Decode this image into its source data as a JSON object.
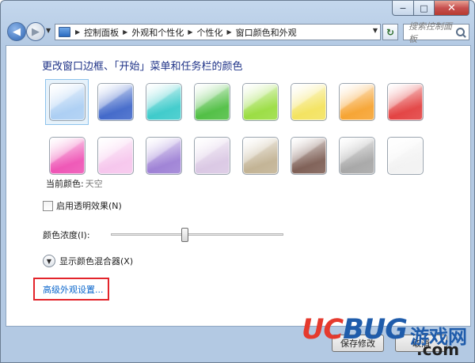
{
  "window": {
    "caption": {
      "minimize": "−",
      "maximize": "□",
      "close": "✕"
    }
  },
  "nav": {
    "back": "◀",
    "forward": "▶",
    "breadcrumbs": [
      "控制面板",
      "外观和个性化",
      "个性化",
      "窗口颜色和外观"
    ],
    "refresh": "↻",
    "search_placeholder": "搜索控制面板"
  },
  "main": {
    "heading": "更改窗口边框、「开始」菜单和任务栏的颜色",
    "swatches": [
      {
        "color": "#a9cdf3",
        "selected": true
      },
      {
        "color": "#3c64c8",
        "selected": false
      },
      {
        "color": "#37c9c9",
        "selected": false
      },
      {
        "color": "#4bbd3e",
        "selected": false
      },
      {
        "color": "#97dc3c",
        "selected": false
      },
      {
        "color": "#f3e25a",
        "selected": false
      },
      {
        "color": "#f6a12c",
        "selected": false
      },
      {
        "color": "#e23c3c",
        "selected": false
      },
      {
        "color": "#ee4fb3",
        "selected": false
      },
      {
        "color": "#f6c4ec",
        "selected": false
      },
      {
        "color": "#9b7dd4",
        "selected": false
      },
      {
        "color": "#d9c6e3",
        "selected": false
      },
      {
        "color": "#c0b090",
        "selected": false
      },
      {
        "color": "#7a5a50",
        "selected": false
      },
      {
        "color": "#a4a4a4",
        "selected": false
      },
      {
        "color": "#f2f2f2",
        "selected": false
      }
    ],
    "current_color_label": "当前颜色:",
    "current_color_value": "天空",
    "transparency_label": "启用透明效果(N)",
    "transparency_checked": false,
    "intensity_label": "颜色浓度(I):",
    "intensity_value": 0.42,
    "mixer_label": "显示颜色混合器(X)",
    "mixer_icon": "chevron-down-icon",
    "advanced_link": "高级外观设置...",
    "highlight_color": "#e3242b"
  },
  "footer": {
    "save_label": "保存修改",
    "cancel_label": "取消"
  },
  "watermark": {
    "brand_uc": "UC",
    "brand_bug": "BUG",
    "brand_cn": "游戏网",
    "brand_com": ".com"
  }
}
